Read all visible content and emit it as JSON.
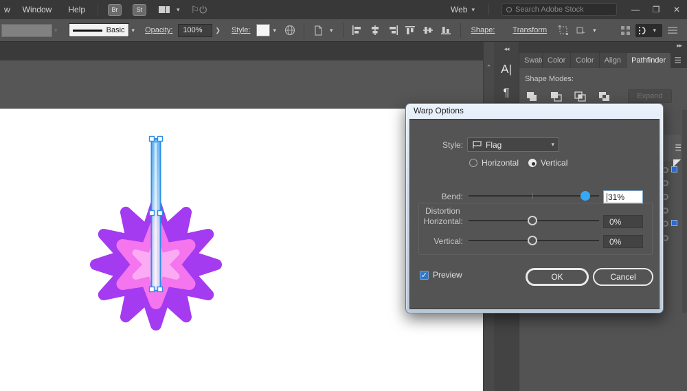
{
  "menubar": {
    "items": [
      "w",
      "Window",
      "Help"
    ],
    "badges": [
      "Br",
      "St"
    ],
    "workspace_switcher": "Web",
    "search_placeholder": "Search Adobe Stock",
    "minimize": "—",
    "restore": "❐",
    "close": "✕"
  },
  "toolbar": {
    "stroke_style": "Basic",
    "opacity_label": "Opacity:",
    "opacity_value": "100%",
    "style_label": "Style:",
    "shape_label": "Shape:",
    "transform_label": "Transform"
  },
  "panels": {
    "collapse_left": "◂◂",
    "collapse_right": "▸▸",
    "tabs": [
      "Swatc",
      "Color",
      "Color",
      "Align",
      "Pathfinder"
    ],
    "active_tab": "Pathfinder",
    "shape_modes_label": "Shape Modes:",
    "expand_label": "Expand",
    "char_icon": "A|",
    "para_icon": "¶"
  },
  "dialog": {
    "title": "Warp Options",
    "style_label": "Style:",
    "style_value": "Flag",
    "radio_horizontal": "Horizontal",
    "radio_vertical": "Vertical",
    "selected_radio": "Vertical",
    "bend_label": "Bend:",
    "bend_value": "31%",
    "distortion_label": "Distortion",
    "horizontal_label": "Horizontal:",
    "horizontal_value": "0%",
    "vertical_label": "Vertical:",
    "vertical_value": "0%",
    "preview_label": "Preview",
    "preview_checked": true,
    "ok_label": "OK",
    "cancel_label": "Cancel"
  },
  "artwork": {
    "star_color": "#a43bf0",
    "flower_color": "#f575ef",
    "inner_flower_color": "#fbabf3",
    "ribbon_stroke": "#2e8ee8",
    "ribbon_top": "#6db9f3",
    "ribbon_bottom": "#e3dcf6",
    "handle_fill": "#ffffff",
    "accent_blue": "#38a8f5"
  }
}
